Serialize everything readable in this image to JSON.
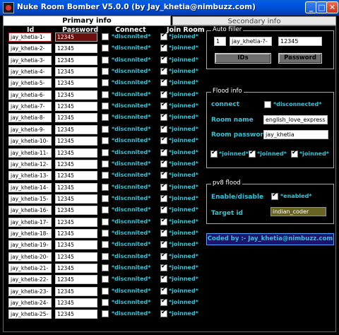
{
  "window": {
    "title": "Nuke Room Bomber V5.0.0 (by Jay_khetia@nimbuzz.com)",
    "buttons": {
      "minimize": "_",
      "maximize": "□",
      "close": "✕"
    }
  },
  "tabs": [
    {
      "label": "Primary info",
      "active": true
    },
    {
      "label": "Secondary info",
      "active": false
    }
  ],
  "columns": {
    "id": "Id",
    "password": "Password",
    "connect": "Connect",
    "join": "Join Room"
  },
  "rows": [
    {
      "id": "jay_khetia-1-",
      "password": "12345",
      "connect": "*discnnited*",
      "join": "*joinned*",
      "connect_checked": false,
      "join_checked": true
    },
    {
      "id": "jay_khetia-2-",
      "password": "12345",
      "connect": "*discnnited*",
      "join": "*joinned*",
      "connect_checked": false,
      "join_checked": true
    },
    {
      "id": "jay_khetia-3-",
      "password": "12345",
      "connect": "*discnnited*",
      "join": "*joinned*",
      "connect_checked": false,
      "join_checked": true
    },
    {
      "id": "jay_khetia-4-",
      "password": "12345",
      "connect": "*discnnited*",
      "join": "*joinned*",
      "connect_checked": false,
      "join_checked": true
    },
    {
      "id": "jay_khetia-5-",
      "password": "12345",
      "connect": "*discnnited*",
      "join": "*joinned*",
      "connect_checked": false,
      "join_checked": true
    },
    {
      "id": "jay_khetia-6-",
      "password": "12345",
      "connect": "*discnnited*",
      "join": "*joinned*",
      "connect_checked": false,
      "join_checked": true
    },
    {
      "id": "jay_khetia-7-",
      "password": "12345",
      "connect": "*discnnited*",
      "join": "*joinned*",
      "connect_checked": false,
      "join_checked": true
    },
    {
      "id": "jay_khetia-8-",
      "password": "12345",
      "connect": "*discnnited*",
      "join": "*joinned*",
      "connect_checked": false,
      "join_checked": true
    },
    {
      "id": "jay_khetia-9-",
      "password": "12345",
      "connect": "*discnnited*",
      "join": "*joinned*",
      "connect_checked": false,
      "join_checked": true
    },
    {
      "id": "jay_khetia-10-",
      "password": "12345",
      "connect": "*discnnited*",
      "join": "*joinned*",
      "connect_checked": false,
      "join_checked": true
    },
    {
      "id": "jay_khetia-11-",
      "password": "12345",
      "connect": "*discnnited*",
      "join": "*joinned*",
      "connect_checked": false,
      "join_checked": true
    },
    {
      "id": "jay_khetia-12-",
      "password": "12345",
      "connect": "*discnnited*",
      "join": "*joinned*",
      "connect_checked": false,
      "join_checked": true
    },
    {
      "id": "jay_khetia-13-",
      "password": "12345",
      "connect": "*discnnited*",
      "join": "*joinned*",
      "connect_checked": false,
      "join_checked": true
    },
    {
      "id": "jay_khetia-14-",
      "password": "12345",
      "connect": "*discnnited*",
      "join": "*joinned*",
      "connect_checked": false,
      "join_checked": true
    },
    {
      "id": "jay_khetia-15-",
      "password": "12345",
      "connect": "*discnnited*",
      "join": "*joinned*",
      "connect_checked": false,
      "join_checked": true
    },
    {
      "id": "jay_khetia-16-",
      "password": "12345",
      "connect": "*discnnited*",
      "join": "*joinned*",
      "connect_checked": false,
      "join_checked": true
    },
    {
      "id": "jay_khetia-17-",
      "password": "12345",
      "connect": "*discnnited*",
      "join": "*joinned*",
      "connect_checked": false,
      "join_checked": true
    },
    {
      "id": "jay_khetia-18-",
      "password": "12345",
      "connect": "*discnnited*",
      "join": "*joinned*",
      "connect_checked": false,
      "join_checked": true
    },
    {
      "id": "jay_khetia-19-",
      "password": "12345",
      "connect": "*discnnited*",
      "join": "*joinned*",
      "connect_checked": false,
      "join_checked": true
    },
    {
      "id": "jay_khetia-20-",
      "password": "12345",
      "connect": "*discnnited*",
      "join": "*joinned*",
      "connect_checked": false,
      "join_checked": true
    },
    {
      "id": "jay_khetia-21-",
      "password": "12345",
      "connect": "*discnnited*",
      "join": "*joinned*",
      "connect_checked": false,
      "join_checked": true
    },
    {
      "id": "jay_khetia-22-",
      "password": "12345",
      "connect": "*discnnited*",
      "join": "*joinned*",
      "connect_checked": false,
      "join_checked": true
    },
    {
      "id": "jay_khetia-23-",
      "password": "12345",
      "connect": "*discnnited*",
      "join": "*joinned*",
      "connect_checked": false,
      "join_checked": true
    },
    {
      "id": "jay_khetia-24-",
      "password": "12345",
      "connect": "*discnnited*",
      "join": "*joinned*",
      "connect_checked": false,
      "join_checked": true
    },
    {
      "id": "jay_khetia-25-",
      "password": "12345",
      "connect": "*discnnited*",
      "join": "*joinned*",
      "connect_checked": false,
      "join_checked": true
    }
  ],
  "auto_filler": {
    "title": "Auto filler",
    "start": "1",
    "id": "jay_khetia-?-",
    "password": "12345",
    "ids_button": "IDs",
    "password_button": "Password"
  },
  "flood": {
    "title": "Flood info",
    "connect_label": "connect",
    "connect_status": "*disconnected*",
    "connect_checked": false,
    "room_name_label": "Room name",
    "room_name": "english_love_express",
    "room_password_label": "Room password",
    "room_password": "jay_khetia",
    "joins": [
      {
        "label": "*joinned*",
        "checked": true
      },
      {
        "label": "*joinned*",
        "checked": true
      },
      {
        "label": "*joinned*",
        "checked": true
      }
    ]
  },
  "pv8": {
    "title": "pv8 flood",
    "enable_label": "Enable/disable",
    "enable_status": "*enabled*",
    "enable_checked": true,
    "target_label": "Target id",
    "target_id": "indian_coder"
  },
  "credit": "Coded by :- Jay_khetia@nimbuzz.com",
  "colors": {
    "accent": "#2ec5d8",
    "title_bar": "#0058e8",
    "credit_bg": "#1a1670"
  }
}
